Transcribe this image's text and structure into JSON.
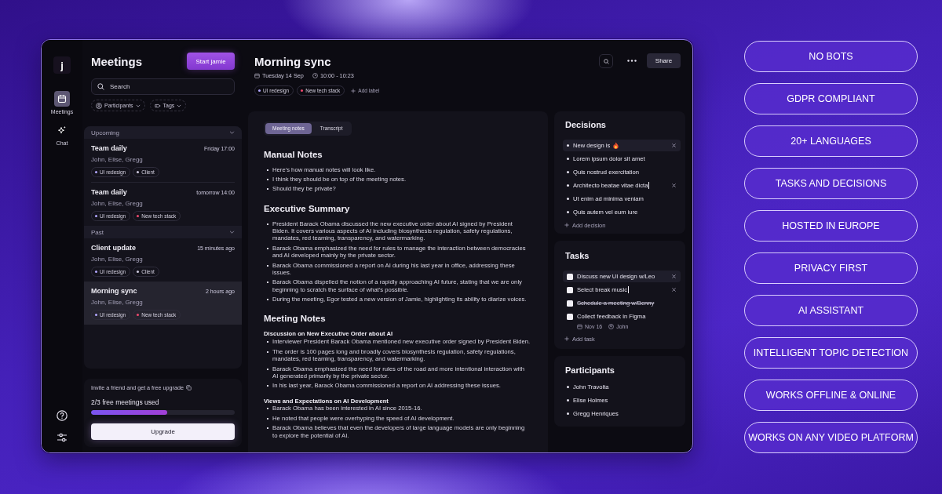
{
  "window": {
    "logo": "j"
  },
  "rail": {
    "items": [
      {
        "label": "Meetings",
        "selected": true
      },
      {
        "label": "Chat",
        "selected": false
      }
    ]
  },
  "meetings_panel": {
    "title": "Meetings",
    "start_button": "Start jamie",
    "search": {
      "placeholder": "Search"
    },
    "filters": [
      "Participants",
      "Tags"
    ],
    "groups": [
      {
        "label": "Upcoming",
        "expanded": true,
        "meetings": [
          {
            "title": "Team daily",
            "time": "Friday 17:00",
            "participants": "John, Elise, Gregg",
            "tags": [
              {
                "label": "UI redesign",
                "color": "#b3a8ff"
              },
              {
                "label": "Client",
                "color": "#cfcbe0"
              }
            ],
            "selected": false
          },
          {
            "title": "Team daily",
            "time": "tomorrow 14:00",
            "participants": "John, Elise, Gregg",
            "tags": [
              {
                "label": "UI redesign",
                "color": "#b3a8ff"
              },
              {
                "label": "New tech stack",
                "color": "#f04a6f"
              }
            ],
            "selected": false
          }
        ]
      },
      {
        "label": "Past",
        "expanded": true,
        "meetings": [
          {
            "title": "Client update",
            "time": "15 minutes ago",
            "participants": "John, Elise, Gregg",
            "tags": [
              {
                "label": "UI redesign",
                "color": "#b3a8ff"
              },
              {
                "label": "Client",
                "color": "#cfcbe0"
              }
            ],
            "selected": false
          },
          {
            "title": "Morning sync",
            "time": "2 hours ago",
            "participants": "John, Elise, Gregg",
            "tags": [
              {
                "label": "UI redesign",
                "color": "#b3a8ff"
              },
              {
                "label": "New tech stack",
                "color": "#f04a6f"
              }
            ],
            "selected": true
          }
        ]
      }
    ],
    "invite": "Invite a friend and get a free upgrade",
    "usage": {
      "label": "2/3 free meetings used",
      "level": 0.53
    },
    "upgrade_button": "Upgrade"
  },
  "meeting": {
    "title": "Morning sync",
    "date": "Tuesday 14 Sep",
    "time": "10:00 - 10:23",
    "tags": [
      {
        "label": "UI redesign",
        "color": "#b3a8ff"
      },
      {
        "label": "New tech stack",
        "color": "#f04a6f"
      }
    ],
    "add_label": "Add label",
    "share_button": "Share"
  },
  "notes": {
    "tabs": [
      {
        "label": "Meeting notes",
        "selected": true
      },
      {
        "label": "Transcript",
        "selected": false
      }
    ],
    "sections": [
      {
        "heading": "Manual Notes",
        "blocks": [
          {
            "bullets": [
              "Here's how manual notes will look like.",
              "I think they should be on top of the meeting notes.",
              "Should they be private?"
            ]
          }
        ]
      },
      {
        "heading": "Executive Summary",
        "blocks": [
          {
            "bullets": [
              "President Barack Obama discussed the new executive order about AI signed by President Biden. It covers various aspects of AI including biosynthesis regulation, safety regulations, mandates, red teaming, transparency, and watermarking.",
              "Barack Obama emphasized the need for rules to manage the interaction between democracies and AI developed mainly by the private sector.",
              "Barack Obama commissioned a report on AI during his last year in office, addressing these issues.",
              "Barack Obama dispelled the notion of a rapidly approaching AI future, stating that we are only beginning to scratch the surface of what's possible.",
              "During the meeting, Egor tested a new version of Jamie, highlighting its ability to diarize voices."
            ]
          }
        ]
      },
      {
        "heading": "Meeting Notes",
        "blocks": [
          {
            "subheading": "Discussion on New Executive Order about AI",
            "bullets": [
              "Interviewer President Barack Obama mentioned new executive order signed by President Biden.",
              "The order is 100 pages long and broadly covers biosynthesis regulation, safety regulations, mandates, red teaming, transparency, and watermarking.",
              "Barack Obama emphasized the need for rules of the road and more intentional interaction with AI generated primarily by the private sector.",
              "In his last year, Barack Obama commissioned a report on AI addressing these issues."
            ]
          },
          {
            "subheading": "Views and Expectations on AI Development",
            "bullets": [
              "Barack Obama has been interested in AI since 2015-16.",
              "He noted that people were overhyping the speed of AI development.",
              "Barack Obama believes that even the developers of large language models are only beginning to explore the potential of AI."
            ]
          }
        ]
      }
    ]
  },
  "decisions": {
    "title": "Decisions",
    "items": [
      {
        "text": "New design is",
        "has_icon": true,
        "highlighted": true,
        "editing": false
      },
      {
        "text": "Lorem ipsum dolor sit amet",
        "has_icon": false,
        "highlighted": false,
        "editing": false
      },
      {
        "text": "Quis nostrud exercitation",
        "has_icon": false,
        "highlighted": false,
        "editing": false
      },
      {
        "text": "Architecto beatae vitae dicta",
        "has_icon": false,
        "highlighted": false,
        "editing": true
      },
      {
        "text": "Ut enim ad minima veniam",
        "has_icon": false,
        "highlighted": false,
        "editing": false
      },
      {
        "text": "Quis autem vel eum iure",
        "has_icon": false,
        "highlighted": false,
        "editing": false
      }
    ],
    "add": "Add decision"
  },
  "tasks": {
    "title": "Tasks",
    "items": [
      {
        "text": "Discuss new UI design w/Leo",
        "done": false,
        "highlighted": true,
        "editing": false
      },
      {
        "text": "Select break music",
        "done": false,
        "highlighted": false,
        "editing": true
      },
      {
        "text": "Schedule a meeting w/Benny",
        "done": true,
        "highlighted": false,
        "editing": false
      },
      {
        "text": "Collect feedback in Figma",
        "done": false,
        "highlighted": false,
        "editing": false,
        "due": "Nov 16",
        "assignee": "John"
      }
    ],
    "add": "Add task"
  },
  "participants": {
    "title": "Participants",
    "names": [
      "John Travolta",
      "Elise Holmes",
      "Gregg Henriques"
    ]
  },
  "features": [
    "NO BOTS",
    "GDPR COMPLIANT",
    "20+ LANGUAGES",
    "TASKS AND DECISIONS",
    "HOSTED IN EUROPE",
    "PRIVACY FIRST",
    "AI ASSISTANT",
    "INTELLIGENT TOPIC DETECTION",
    "WORKS OFFLINE & ONLINE",
    "WORKS ON ANY VIDEO PLATFORM"
  ]
}
